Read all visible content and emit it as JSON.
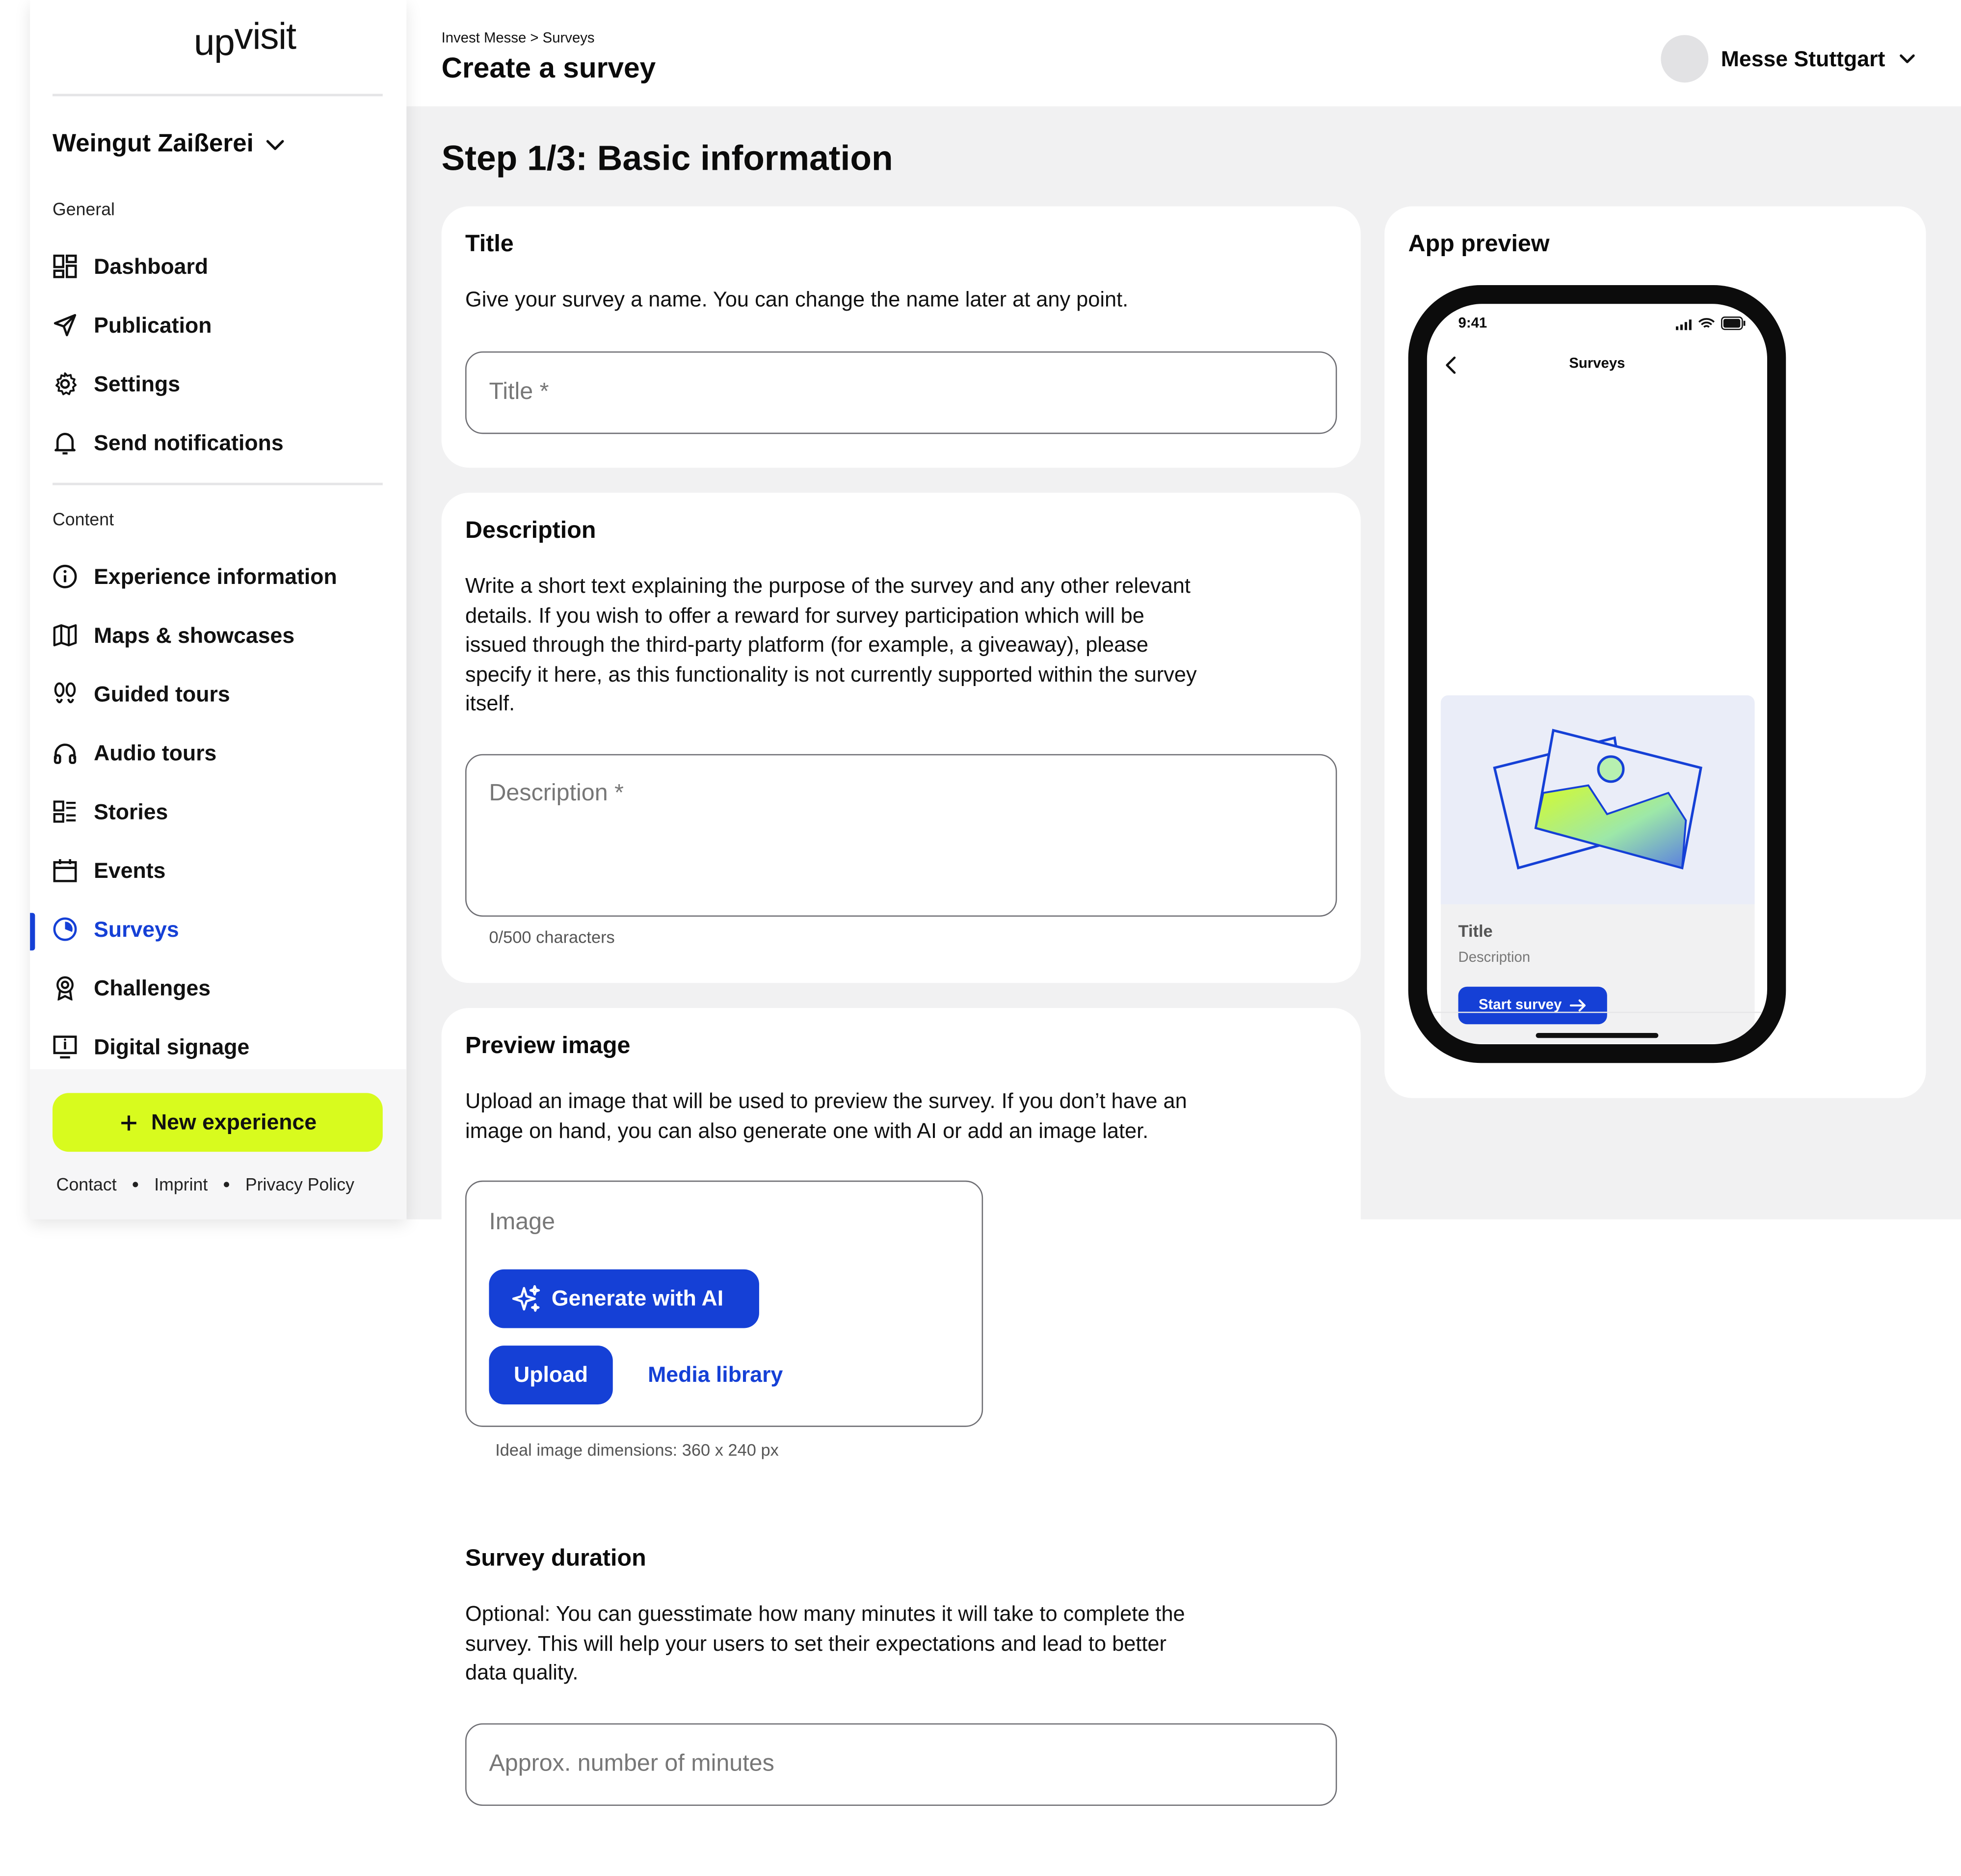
{
  "app": {
    "logo_up": "up",
    "logo_visit": "visit",
    "org_name": "Weingut Zaißerei"
  },
  "sidebar": {
    "general_label": "General",
    "content_label": "Content",
    "general_items": [
      {
        "label": "Dashboard",
        "icon": "dashboard-icon"
      },
      {
        "label": "Publication",
        "icon": "send-icon"
      },
      {
        "label": "Settings",
        "icon": "gear-icon"
      },
      {
        "label": "Send notifications",
        "icon": "bell-icon"
      }
    ],
    "content_items": [
      {
        "label": "Experience information",
        "icon": "info-icon"
      },
      {
        "label": "Maps & showcases",
        "icon": "map-icon"
      },
      {
        "label": "Guided tours",
        "icon": "footprints-icon"
      },
      {
        "label": "Audio tours",
        "icon": "headphones-icon"
      },
      {
        "label": "Stories",
        "icon": "stories-icon"
      },
      {
        "label": "Events",
        "icon": "calendar-icon"
      },
      {
        "label": "Surveys",
        "icon": "pie-icon",
        "active": true
      },
      {
        "label": "Challenges",
        "icon": "award-icon"
      },
      {
        "label": "Digital signage",
        "icon": "signage-icon"
      }
    ],
    "new_experience": "New experience",
    "footer": {
      "contact": "Contact",
      "imprint": "Imprint",
      "privacy": "Privacy Policy"
    }
  },
  "header": {
    "breadcrumb": "Invest Messe > Surveys",
    "title": "Create a survey",
    "user_name": "Messe Stuttgart"
  },
  "main": {
    "step_title": "Step 1/3: Basic information",
    "title_card": {
      "heading": "Title",
      "text": "Give your survey a name. You can change the name later at any point.",
      "placeholder": "Title *"
    },
    "description_card": {
      "heading": "Description",
      "lines": [
        "Write a short text explaining the purpose of the survey and any other relevant",
        "details. If you wish to offer a reward for survey participation which will be",
        "issued through the third-party platform (for example, a giveaway), please",
        "specify it here, as this functionality is not currently supported within the survey",
        "itself."
      ],
      "placeholder": "Description *",
      "counter": "0/500 characters"
    },
    "image_card": {
      "heading": "Preview image",
      "lines": [
        "Upload an image that will be used to preview the survey. If you don’t have an",
        "image on hand, you can also generate one with AI or add an image later."
      ],
      "box_label": "Image",
      "generate": "Generate with AI",
      "upload": "Upload",
      "media_library": "Media library",
      "hint": "Ideal image dimensions: 360 x 240 px"
    },
    "duration_card": {
      "heading": "Survey duration",
      "lines": [
        "Optional: You can guesstimate how many minutes it will take to complete the",
        "survey. This will help your users to set their expectations and lead to better",
        "data quality."
      ],
      "placeholder": "Approx. number of minutes"
    }
  },
  "preview": {
    "heading": "App preview",
    "time": "9:41",
    "screen_title": "Surveys",
    "card_title": "Title",
    "card_desc": "Description",
    "start_button": "Start survey"
  },
  "colors": {
    "accent": "#1540d6",
    "cta": "#d8fb1e",
    "background": "#f1f1f2"
  }
}
